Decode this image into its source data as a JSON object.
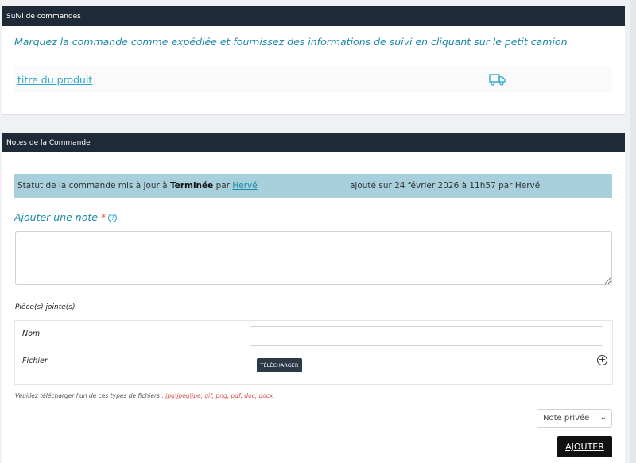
{
  "tracking": {
    "header": "Suivi de commandes",
    "instructions": "Marquez la commande comme expédiée et fournissez des informations de suivi en cliquant sur le petit camion",
    "product_link": "titre du produit",
    "truck_icon": "truck-icon"
  },
  "notes": {
    "header": "Notes de la Commande",
    "status": {
      "prefix": "Statut de la commande mis à jour à ",
      "status": "Terminée",
      "by": " par ",
      "user": "Hervé",
      "added": "ajouté sur 24 février 2026 à 11h57 par Hervé"
    },
    "add_note_label": "Ajouter une note",
    "required_mark": "*",
    "help_glyph": "?",
    "note_value": "",
    "attachments_label": "Pièce(s) jointe(s)",
    "name_label": "Nom",
    "name_value": "",
    "file_label": "Fichier",
    "upload_button": "TÉLÉCHARGER",
    "plus_glyph": "+",
    "file_types_prefix": "Veuillez télécharger l'un de ces types de fichiers : ",
    "file_types": "jpg|jpeg|jpe, gif, png, pdf, doc, docx",
    "note_type_selected": "Note privée",
    "add_button": "AJOUTER"
  }
}
